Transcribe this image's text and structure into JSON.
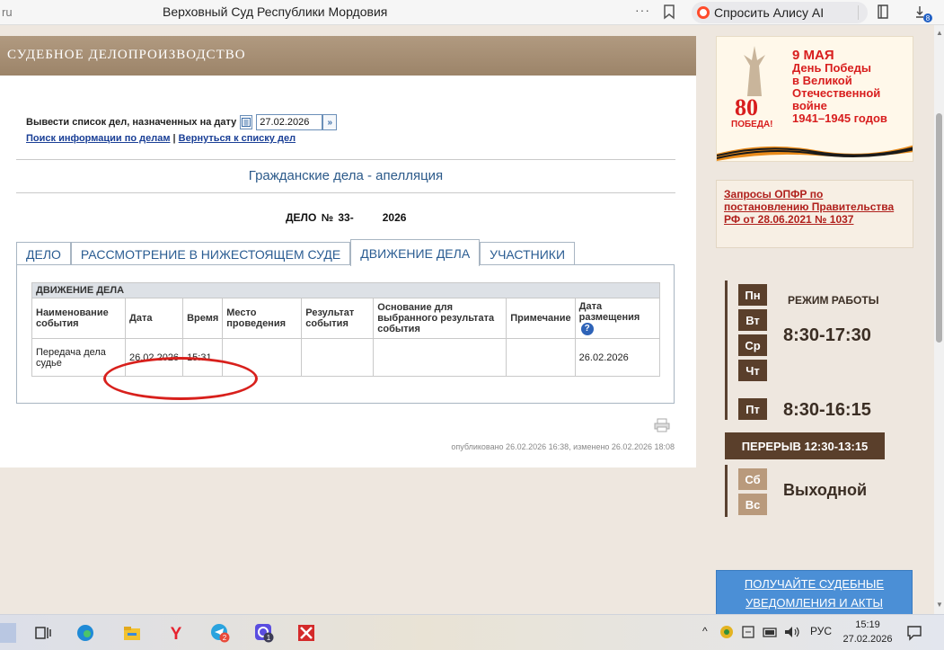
{
  "browser": {
    "url_fragment": "ru",
    "page_title": "Верховный Суд Республики Мордовия",
    "menu_dots": "···",
    "alice_label": "Спросить Алису AI",
    "downloads_badge": "8"
  },
  "header": {
    "title": "СУДЕБНОЕ ДЕЛОПРОИЗВОДСТВО"
  },
  "date_filter": {
    "label": "Вывести список дел, назначенных на дату",
    "date_value": "27.02.2026",
    "link_search": "Поиск информации по делам",
    "link_separator": "|",
    "link_back": "Вернуться к списку дел"
  },
  "case": {
    "type": "Гражданские дела - апелляция",
    "number_label": "ДЕЛО № 33-",
    "number_year": "2026"
  },
  "tabs": [
    {
      "label": "ДЕЛО",
      "active": false
    },
    {
      "label": "РАССМОТРЕНИЕ В НИЖЕСТОЯЩЕМ СУДЕ",
      "active": false
    },
    {
      "label": "ДВИЖЕНИЕ ДЕЛА",
      "active": true
    },
    {
      "label": "УЧАСТНИКИ",
      "active": false
    }
  ],
  "movement_table": {
    "caption": "ДВИЖЕНИЕ ДЕЛА",
    "headers": [
      "Наименование события",
      "Дата",
      "Время",
      "Место проведения",
      "Результат события",
      "Основание для выбранного результата события",
      "Примечание",
      "Дата размещения"
    ],
    "help_icon": "?",
    "rows": [
      [
        "Передача дела судье",
        "26.02.2026",
        "15:31",
        "",
        "",
        "",
        "",
        "26.02.2026"
      ]
    ]
  },
  "published_note": "опубликовано 26.02.2026 16:38, изменено 26.02.2026 18:08",
  "sidebar": {
    "promo": {
      "number": "80",
      "pobeda": "ПОБЕДА!",
      "date": "9 МАЯ",
      "lines": [
        "День Победы",
        "в Великой",
        "Отечественной войне",
        "1941–1945 годов"
      ]
    },
    "notice_link": "Запросы ОПФР по постановлению Правительства РФ от 28.06.2021 № 1037",
    "hours": {
      "title": "РЕЖИМ РАБОТЫ",
      "weekdays": [
        "Пн",
        "Вт",
        "Ср",
        "Чт"
      ],
      "weekday_time": "8:30-17:30",
      "friday": "Пт",
      "friday_time": "8:30-16:15",
      "break": "ПЕРЕРЫВ 12:30-13:15",
      "weekend_days": [
        "Сб",
        "Вс"
      ],
      "weekend_label": "Выходной"
    },
    "notify_button": "ПОЛУЧАЙТЕ СУДЕБНЫЕ УВЕДОМЛЕНИЯ И АКТЫ"
  },
  "taskbar": {
    "lang": "РУС",
    "time": "15:19",
    "date": "27.02.2026",
    "telegram_badge": "2",
    "max_badge": "1"
  },
  "colors": {
    "header_band": "#a58c71",
    "link_blue": "#1a3f96",
    "tab_text": "#2a5c92",
    "annotation_red": "#d8201c",
    "hours_brown": "#5a3f2b",
    "notify_blue": "#4b8fd6"
  }
}
